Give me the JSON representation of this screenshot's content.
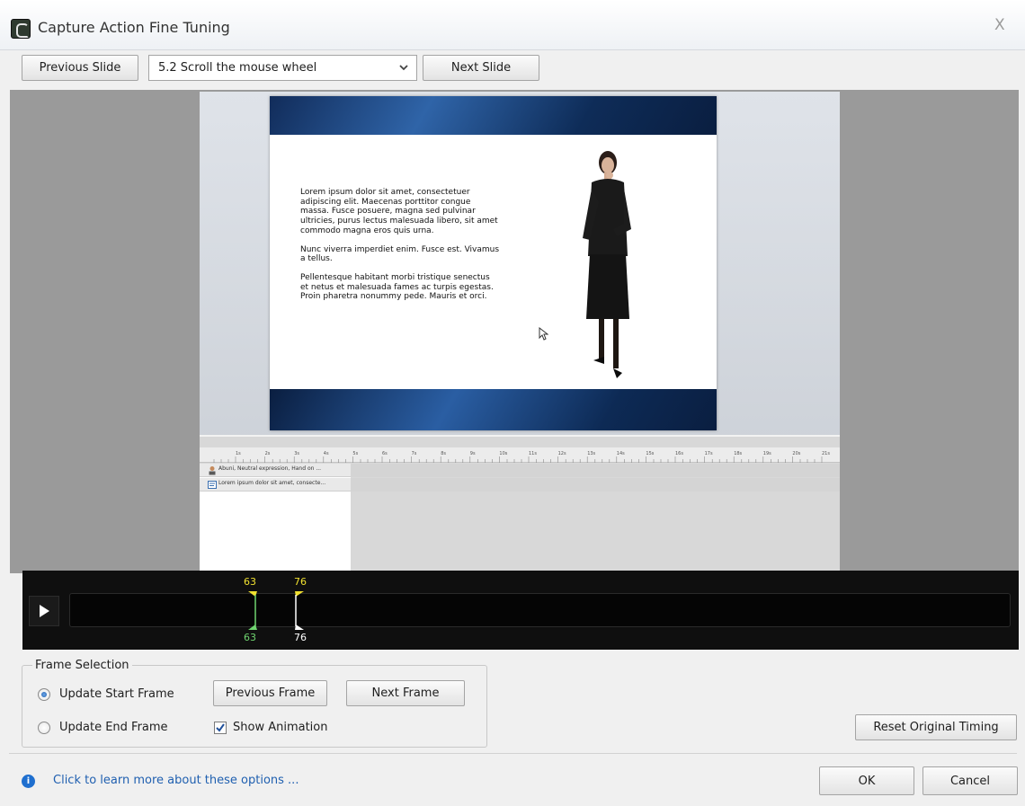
{
  "window": {
    "title": "Capture Action Fine Tuning",
    "close_glyph": "X"
  },
  "toolbar": {
    "previous_slide": "Previous Slide",
    "slide_select_value": "5.2 Scroll the mouse wheel",
    "next_slide": "Next Slide"
  },
  "slide": {
    "paragraphs": [
      "Lorem ipsum dolor sit amet, consectetuer adipiscing elit. Maecenas porttitor congue massa. Fusce posuere, magna sed pulvinar ultricies, purus lectus malesuada libero, sit amet commodo magna eros quis urna.",
      "Nunc viverra imperdiet enim. Fusce est. Vivamus a tellus.",
      "Pellentesque habitant morbi tristique senectus et netus et malesuada fames ac turpis egestas. Proin pharetra nonummy pede. Mauris et orci."
    ]
  },
  "timeline": {
    "ruler_ticks": [
      "1s",
      "2s",
      "3s",
      "4s",
      "5s",
      "6s",
      "7s",
      "8s",
      "9s",
      "10s",
      "11s",
      "12s",
      "13s",
      "14s",
      "15s",
      "16s",
      "17s",
      "18s",
      "19s",
      "20s",
      "21s"
    ],
    "rows": [
      {
        "label": "Abuni, Neutral expression, Hand on ...",
        "icon": "person-icon"
      },
      {
        "label": "Lorem ipsum dolor sit amet, consecte...",
        "icon": "text-caption-icon"
      }
    ]
  },
  "scrubber": {
    "start_frame_top": "63",
    "end_frame_top": "76",
    "start_frame_bottom": "63",
    "end_frame_bottom": "76",
    "colors": {
      "start_marker": "#f0e030",
      "start_bottom": "#6fd46f",
      "end_bottom": "#ffffff"
    }
  },
  "frame_selection": {
    "title": "Frame Selection",
    "update_start": "Update Start Frame",
    "update_end": "Update End Frame",
    "previous_frame": "Previous Frame",
    "next_frame": "Next Frame",
    "show_animation": "Show Animation",
    "selected": "Update Start Frame",
    "show_animation_checked": true
  },
  "footer": {
    "reset": "Reset Original Timing",
    "info_link": "Click to learn more about these options ...",
    "ok": "OK",
    "cancel": "Cancel"
  }
}
